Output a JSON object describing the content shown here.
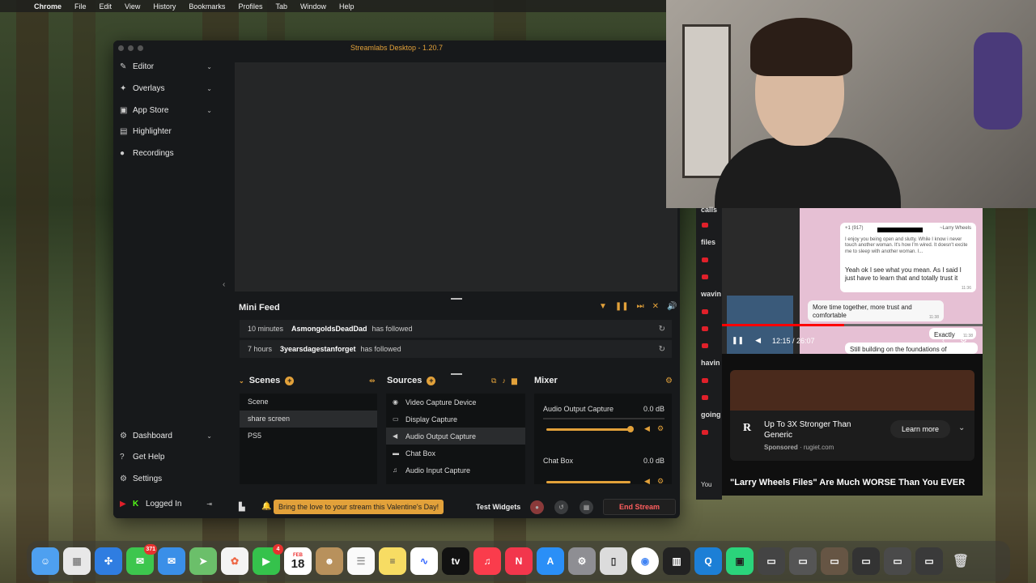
{
  "menubar": {
    "app": "Chrome",
    "items": [
      "File",
      "Edit",
      "View",
      "History",
      "Bookmarks",
      "Profiles",
      "Tab",
      "Window",
      "Help"
    ]
  },
  "streamlabs": {
    "title": "Streamlabs Desktop - 1.20.7",
    "nav": [
      {
        "label": "Editor",
        "icon": "editor-icon"
      },
      {
        "label": "Overlays",
        "icon": "overlays-icon"
      },
      {
        "label": "App Store",
        "icon": "app-store-icon"
      },
      {
        "label": "Highlighter",
        "icon": "highlighter-icon"
      },
      {
        "label": "Recordings",
        "icon": "recordings-icon"
      }
    ],
    "nav_bottom": [
      {
        "label": "Dashboard",
        "icon": "dashboard-icon"
      },
      {
        "label": "Get Help",
        "icon": "help-icon"
      },
      {
        "label": "Settings",
        "icon": "settings-icon"
      },
      {
        "label": "Logged In",
        "icon": "logged-in-icon"
      }
    ],
    "minifeed": {
      "title": "Mini Feed",
      "rows": [
        {
          "time": "10 minutes",
          "user": "AsmongoldsDeadDad",
          "action": "has followed"
        },
        {
          "time": "7 hours",
          "user": "3yearsdagestanforget",
          "action": "has followed"
        }
      ]
    },
    "scenes": {
      "title": "Scenes",
      "items": [
        "Scene",
        "share screen",
        "PS5"
      ],
      "selected": "share screen"
    },
    "sources": {
      "title": "Sources",
      "items": [
        {
          "label": "Video Capture Device",
          "icon": "camera-icon"
        },
        {
          "label": "Display Capture",
          "icon": "monitor-icon"
        },
        {
          "label": "Audio Output Capture",
          "icon": "speaker-icon"
        },
        {
          "label": "Chat Box",
          "icon": "chat-icon"
        },
        {
          "label": "Audio Input Capture",
          "icon": "microphone-icon"
        }
      ],
      "selected": "Audio Output Capture"
    },
    "mixer": {
      "title": "Mixer",
      "channels": [
        {
          "name": "Audio Output Capture",
          "level": "0.0 dB",
          "volume": 1.0
        },
        {
          "name": "Chat Box",
          "level": "0.0 dB",
          "volume": 1.0
        }
      ]
    },
    "bottom": {
      "promo": "Bring the love to your stream this Valentine's Day!",
      "test_widgets": "Test Widgets",
      "end_stream": "End Stream"
    },
    "accent": "#e2a13a"
  },
  "chat_strip": {
    "lines": [
      "calls",
      "files",
      "wavin",
      "havin",
      "going",
      "You"
    ]
  },
  "youtube": {
    "time": "12:15 / 26:07",
    "progress": 0.47,
    "phone": {
      "contact": "~Larry Wheels",
      "phone_number": "+1 (917)",
      "msg1": "I enjoy you being open and slutty. While I know i never touch another woman. It's how I'm wired. It doesn't excite me to sleep with another woman. I...",
      "msg2": "Yeah ok I see what you mean. As I said I just have to learn that and totally trust it",
      "msg3": "More time together, more trust and comfortable",
      "msg4": "Exactly",
      "msg5": "Still building on the foundations of",
      "time1": "11:36",
      "time2": "11:38",
      "time3": "11:38"
    },
    "ad": {
      "logo": "R",
      "title": "Up To 3X Stronger Than Generic",
      "sponsored": "Sponsored",
      "domain": "rugiet.com",
      "cta": "Learn more"
    },
    "video_title": "\"Larry Wheels Files\" Are Much WORSE Than You EVER"
  },
  "dock": {
    "messages_badge": "371",
    "facetime_badge": "4",
    "calendar_month": "FEB",
    "calendar_day": "18"
  }
}
